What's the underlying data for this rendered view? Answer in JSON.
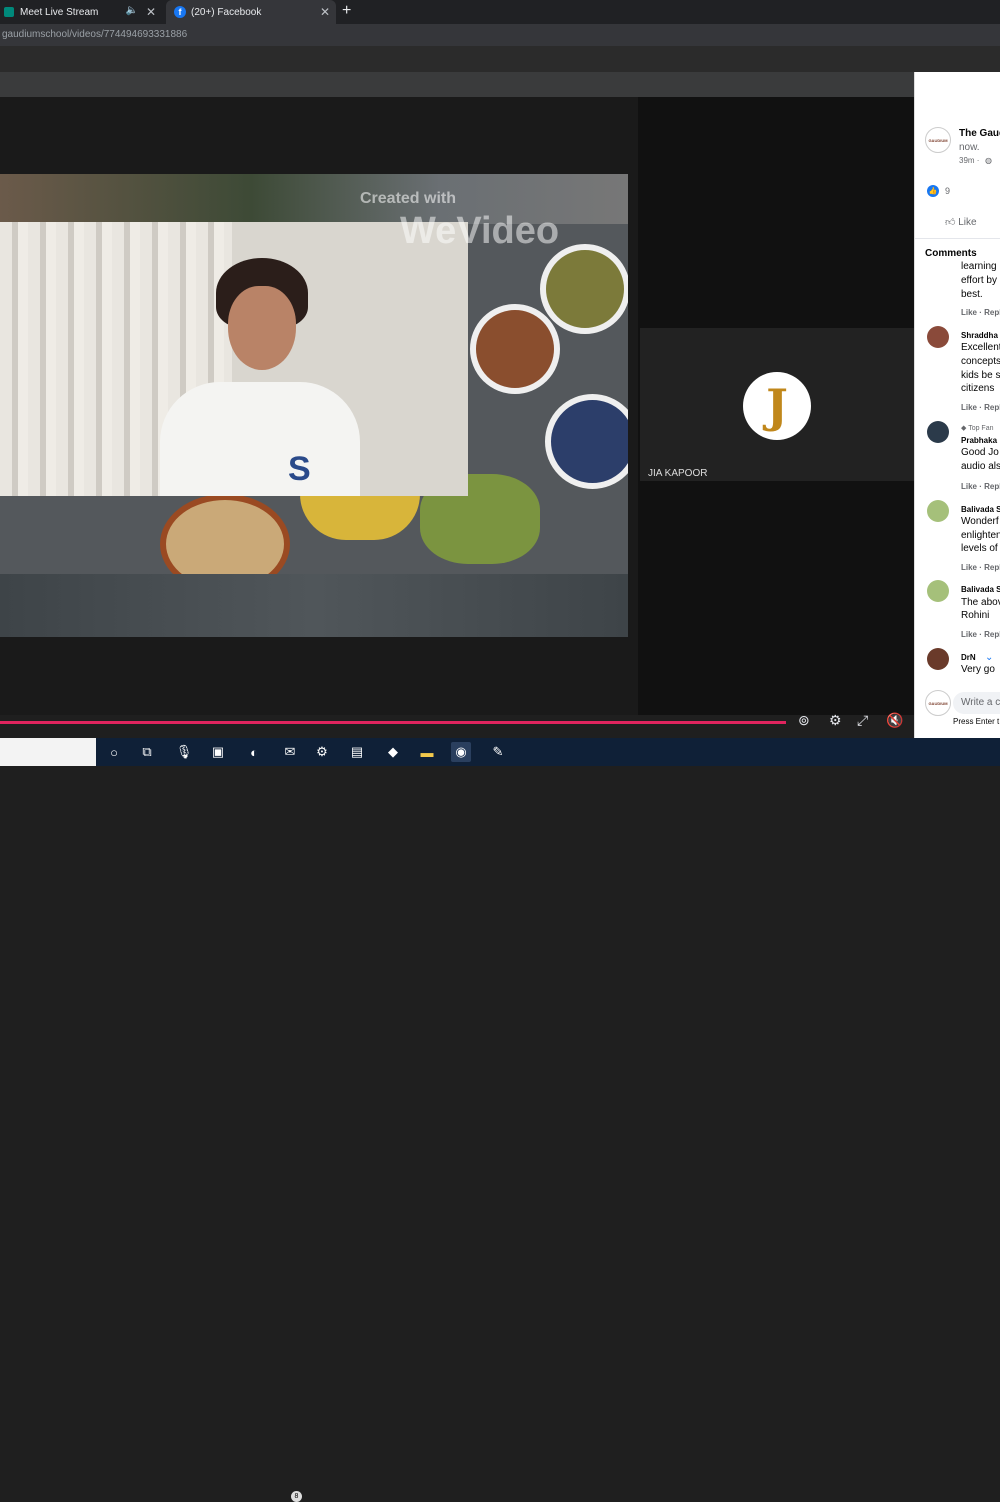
{
  "browser": {
    "tabs": [
      {
        "label": "Meet Live Stream",
        "icon": "google-meet-icon"
      },
      {
        "label": "(20+) Facebook",
        "icon": "facebook-icon"
      }
    ],
    "url": "gaudiumschool/videos/774494693331886"
  },
  "video": {
    "watermark_line1": "Created with",
    "watermark_line2": "WeVideo",
    "shirt_text": "S",
    "participant_name": "JIA KAPOOR",
    "participant_initial": "J"
  },
  "post": {
    "page_name": "The Gaud",
    "subtitle": "now.",
    "time": "39m ·",
    "reaction_count": "9",
    "like_label": "Like",
    "comments_heading": "Comments",
    "comments": [
      {
        "author": "",
        "lines": [
          "learning",
          "effort by",
          "best."
        ],
        "actions": "Like · Repl"
      },
      {
        "author": "Shraddha",
        "lines": [
          "Excellent",
          "concepts",
          "kids be s",
          "citizens"
        ],
        "actions": "Like · Repl"
      },
      {
        "badge": "Top Fan",
        "author": "Prabhaka",
        "lines": [
          "Good Jo",
          "audio als"
        ],
        "actions": "Like · Repl"
      },
      {
        "author": "Balivada S",
        "lines": [
          "Wonderf",
          "enlighten",
          "levels of"
        ],
        "actions": "Like · Repl"
      },
      {
        "author": "Balivada S",
        "lines": [
          "The abov",
          "Rohini"
        ],
        "actions": "Like · Repl"
      },
      {
        "author": "DrN",
        "lines": [
          "Very go"
        ],
        "actions": ""
      }
    ],
    "write_placeholder": "Write a c",
    "press_enter": "Press Enter t",
    "logo_text": "GAUDIUM"
  },
  "taskbar": {
    "mail_badge": "8"
  },
  "colors": {
    "facebook_blue": "#1877f2",
    "seek_red": "#e0245e",
    "taskbar": "#0f2037"
  }
}
